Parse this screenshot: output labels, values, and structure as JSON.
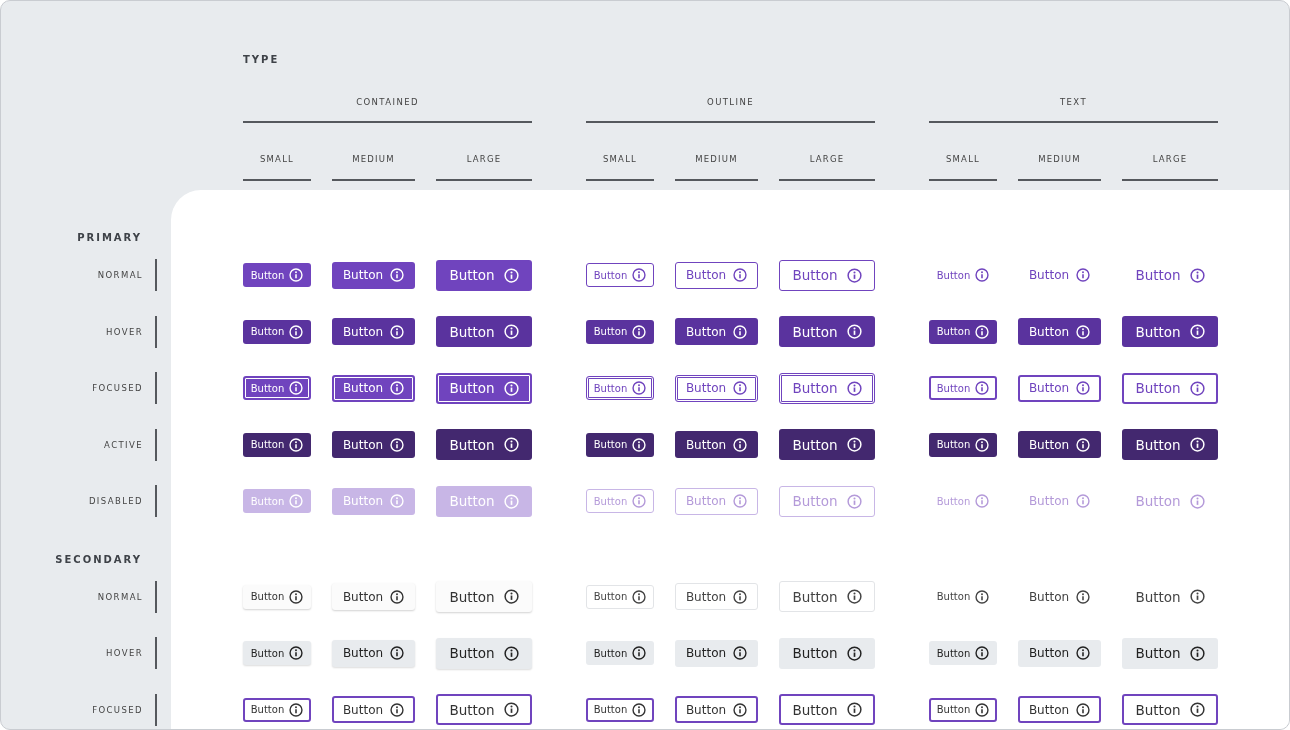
{
  "heading": "TYPE",
  "types": [
    {
      "label": "CONTAINED",
      "kind": "contained",
      "sizes": [
        {
          "label": "SMALL",
          "kind": "small"
        },
        {
          "label": "MEDIUM",
          "kind": "medium"
        },
        {
          "label": "LARGE",
          "kind": "large"
        }
      ]
    },
    {
      "label": "OUTLINE",
      "kind": "outline",
      "sizes": [
        {
          "label": "SMALL",
          "kind": "small"
        },
        {
          "label": "MEDIUM",
          "kind": "medium"
        },
        {
          "label": "LARGE",
          "kind": "large"
        }
      ]
    },
    {
      "label": "TEXT",
      "kind": "text",
      "sizes": [
        {
          "label": "SMALL",
          "kind": "small"
        },
        {
          "label": "MEDIUM",
          "kind": "medium"
        },
        {
          "label": "LARGE",
          "kind": "large"
        }
      ]
    }
  ],
  "groups": [
    {
      "label": "PRIMARY",
      "kind": "primary",
      "states": [
        {
          "label": "NORMAL",
          "kind": "normal",
          "buttons": [
            "Button",
            "Button",
            "Button",
            "Button",
            "Button",
            "Button",
            "Button",
            "Button",
            "Button"
          ]
        },
        {
          "label": "HOVER",
          "kind": "hover",
          "buttons": [
            "Button",
            "Button",
            "Button",
            "Button",
            "Button",
            "Button",
            "Button",
            "Button",
            "Button"
          ]
        },
        {
          "label": "FOCUSED",
          "kind": "focused",
          "buttons": [
            "Button",
            "Button",
            "Button",
            "Button",
            "Button",
            "Button",
            "Button",
            "Button",
            "Button"
          ]
        },
        {
          "label": "ACTIVE",
          "kind": "active",
          "buttons": [
            "Button",
            "Button",
            "Button",
            "Button",
            "Button",
            "Button",
            "Button",
            "Button",
            "Button"
          ]
        },
        {
          "label": "DISABLED",
          "kind": "disabled",
          "buttons": [
            "Button",
            "Button",
            "Button",
            "Button",
            "Button",
            "Button",
            "Button",
            "Button",
            "Button"
          ]
        }
      ]
    },
    {
      "label": "SECONDARY",
      "kind": "secondary",
      "states": [
        {
          "label": "NORMAL",
          "kind": "normal",
          "buttons": [
            "Button",
            "Button",
            "Button",
            "Button",
            "Button",
            "Button",
            "Button",
            "Button",
            "Button"
          ]
        },
        {
          "label": "HOVER",
          "kind": "hover",
          "buttons": [
            "Button",
            "Button",
            "Button",
            "Button",
            "Button",
            "Button",
            "Button",
            "Button",
            "Button"
          ]
        },
        {
          "label": "FOCUSED",
          "kind": "focused",
          "buttons": [
            "Button",
            "Button",
            "Button",
            "Button",
            "Button",
            "Button",
            "Button",
            "Button",
            "Button"
          ]
        }
      ]
    }
  ]
}
